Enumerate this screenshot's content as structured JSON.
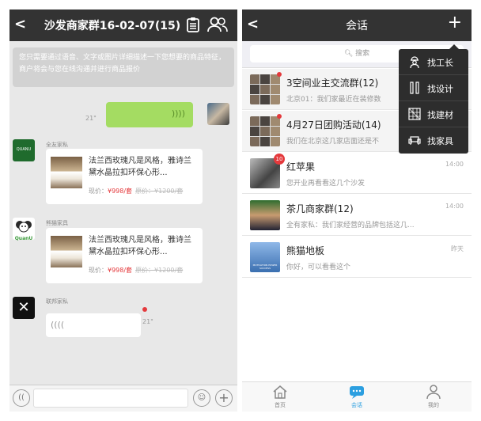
{
  "chat": {
    "title": "沙发商家群16-02-07(15)",
    "notice": "您只需要通过语音、文字或图片详细描述一下您想要的商品特征，商户将会与您在线沟通并进行商品报价",
    "my_voice_duration": "21\"",
    "messages": [
      {
        "sender": "全友家私",
        "desc": "法兰西玫瑰凡是风格，雅诗兰黛水晶拉扣环保心形...",
        "price_label": "现价：",
        "price": "¥998/套",
        "old_price": "原价：¥1200/套"
      },
      {
        "sender": "熊猫家具",
        "desc": "法兰西玫瑰凡是风格，雅诗兰黛水晶拉扣环保心形...",
        "price_label": "现价：",
        "price": "¥998/套",
        "old_price": "原价：¥1200/套"
      },
      {
        "sender": "联邦家私",
        "voice_duration": "21\""
      }
    ],
    "logos": {
      "quanu": "QuanU"
    }
  },
  "conversations": {
    "title": "会话",
    "search_placeholder": "搜索",
    "items": [
      {
        "name": "3空间业主交流群(12)",
        "message": "北京01：我们家最近在装修数",
        "time": ""
      },
      {
        "name": "4月27日团购活动(14)",
        "message": "我们在北京这几家店面还是不",
        "time": ""
      },
      {
        "name": "红苹果",
        "message": "您开业再看看这几个沙发",
        "time": "14:00",
        "badge": "10"
      },
      {
        "name": "茶几商家群(12)",
        "message": "全有家私：我们家经营的品牌包括这几...",
        "time": "14:00"
      },
      {
        "name": "熊猫地板",
        "message": "你好，可以看看这个",
        "time": "昨天",
        "avatar_caption": "MOTIVATION POWER SUCCESS"
      }
    ],
    "menu": [
      "找工长",
      "找设计",
      "找建材",
      "找家具"
    ],
    "tabs": [
      {
        "label": "首页",
        "icon": "home-icon"
      },
      {
        "label": "会话",
        "icon": "chat-icon",
        "active": true
      },
      {
        "label": "我的",
        "icon": "person-icon"
      }
    ]
  },
  "colors": {
    "topbar": "#333333",
    "voice_bubble": "#a4dc62",
    "price": "#e4393c",
    "active_tab": "#2c9fe0"
  }
}
